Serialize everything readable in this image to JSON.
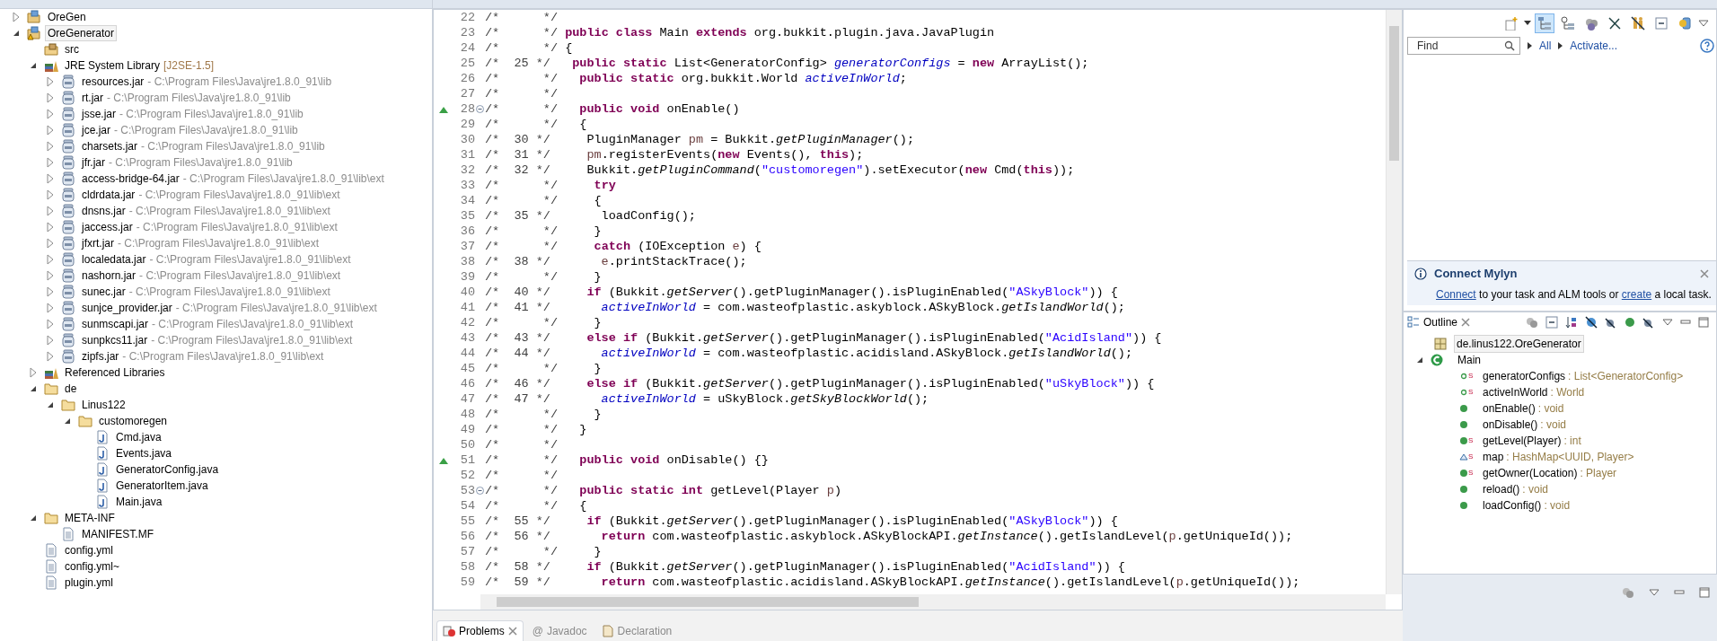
{
  "explorer": {
    "items": [
      {
        "label": "OreGen",
        "kind": "project",
        "expanded": false,
        "selected": false
      },
      {
        "label": "OreGenerator",
        "kind": "project-warning",
        "expanded": true,
        "selected": true,
        "children": [
          {
            "label": "src",
            "kind": "source-folder",
            "selected": false
          },
          {
            "label": "JRE System Library",
            "detail": "[J2SE-1.5]",
            "kind": "library",
            "expanded": true,
            "selected": false,
            "children": [
              {
                "label": "resources.jar",
                "detail": "- C:\\Program Files\\Java\\jre1.8.0_91\\lib",
                "kind": "jar",
                "expanded": false,
                "selected": false
              },
              {
                "label": "rt.jar",
                "detail": "- C:\\Program Files\\Java\\jre1.8.0_91\\lib",
                "kind": "jar",
                "expanded": false,
                "selected": false
              },
              {
                "label": "jsse.jar",
                "detail": "- C:\\Program Files\\Java\\jre1.8.0_91\\lib",
                "kind": "jar",
                "expanded": false,
                "selected": false
              },
              {
                "label": "jce.jar",
                "detail": "- C:\\Program Files\\Java\\jre1.8.0_91\\lib",
                "kind": "jar",
                "expanded": false,
                "selected": false
              },
              {
                "label": "charsets.jar",
                "detail": "- C:\\Program Files\\Java\\jre1.8.0_91\\lib",
                "kind": "jar",
                "expanded": false,
                "selected": false
              },
              {
                "label": "jfr.jar",
                "detail": "- C:\\Program Files\\Java\\jre1.8.0_91\\lib",
                "kind": "jar",
                "expanded": false,
                "selected": false
              },
              {
                "label": "access-bridge-64.jar",
                "detail": "- C:\\Program Files\\Java\\jre1.8.0_91\\lib\\ext",
                "kind": "jar",
                "expanded": false,
                "selected": false
              },
              {
                "label": "cldrdata.jar",
                "detail": "- C:\\Program Files\\Java\\jre1.8.0_91\\lib\\ext",
                "kind": "jar",
                "expanded": false,
                "selected": false
              },
              {
                "label": "dnsns.jar",
                "detail": "- C:\\Program Files\\Java\\jre1.8.0_91\\lib\\ext",
                "kind": "jar",
                "expanded": false,
                "selected": false
              },
              {
                "label": "jaccess.jar",
                "detail": "- C:\\Program Files\\Java\\jre1.8.0_91\\lib\\ext",
                "kind": "jar",
                "expanded": false,
                "selected": false
              },
              {
                "label": "jfxrt.jar",
                "detail": "- C:\\Program Files\\Java\\jre1.8.0_91\\lib\\ext",
                "kind": "jar",
                "expanded": false,
                "selected": false
              },
              {
                "label": "localedata.jar",
                "detail": "- C:\\Program Files\\Java\\jre1.8.0_91\\lib\\ext",
                "kind": "jar",
                "expanded": false,
                "selected": false
              },
              {
                "label": "nashorn.jar",
                "detail": "- C:\\Program Files\\Java\\jre1.8.0_91\\lib\\ext",
                "kind": "jar",
                "expanded": false,
                "selected": false
              },
              {
                "label": "sunec.jar",
                "detail": "- C:\\Program Files\\Java\\jre1.8.0_91\\lib\\ext",
                "kind": "jar",
                "expanded": false,
                "selected": false
              },
              {
                "label": "sunjce_provider.jar",
                "detail": "- C:\\Program Files\\Java\\jre1.8.0_91\\lib\\ext",
                "kind": "jar",
                "expanded": false,
                "selected": false
              },
              {
                "label": "sunmscapi.jar",
                "detail": "- C:\\Program Files\\Java\\jre1.8.0_91\\lib\\ext",
                "kind": "jar",
                "expanded": false,
                "selected": false
              },
              {
                "label": "sunpkcs11.jar",
                "detail": "- C:\\Program Files\\Java\\jre1.8.0_91\\lib\\ext",
                "kind": "jar",
                "expanded": false,
                "selected": false
              },
              {
                "label": "zipfs.jar",
                "detail": "- C:\\Program Files\\Java\\jre1.8.0_91\\lib\\ext",
                "kind": "jar",
                "expanded": false,
                "selected": false
              }
            ]
          },
          {
            "label": "Referenced Libraries",
            "kind": "library",
            "expanded": false,
            "selected": false
          },
          {
            "label": "de",
            "kind": "folder",
            "expanded": true,
            "selected": false,
            "children": [
              {
                "label": "Linus122",
                "kind": "folder",
                "expanded": true,
                "selected": false,
                "children": [
                  {
                    "label": "customoregen",
                    "kind": "folder",
                    "expanded": true,
                    "selected": false,
                    "children": [
                      {
                        "label": "Cmd.java",
                        "kind": "java",
                        "selected": false
                      },
                      {
                        "label": "Events.java",
                        "kind": "java",
                        "selected": false
                      },
                      {
                        "label": "GeneratorConfig.java",
                        "kind": "java",
                        "selected": false
                      },
                      {
                        "label": "GeneratorItem.java",
                        "kind": "java",
                        "selected": false
                      },
                      {
                        "label": "Main.java",
                        "kind": "java",
                        "selected": false
                      }
                    ]
                  }
                ]
              }
            ]
          },
          {
            "label": "META-INF",
            "kind": "folder",
            "expanded": true,
            "selected": false,
            "children": [
              {
                "label": "MANIFEST.MF",
                "kind": "text-file",
                "selected": false
              }
            ]
          },
          {
            "label": "config.yml",
            "kind": "text-file",
            "selected": false
          },
          {
            "label": "config.yml~",
            "kind": "text-file",
            "selected": false
          },
          {
            "label": "plugin.yml",
            "kind": "text-file",
            "selected": false
          }
        ]
      }
    ]
  },
  "editor": {
    "lines": [
      {
        "number": "22",
        "prefix": "/*      */",
        "override": false,
        "collapsible": false
      },
      {
        "number": "23",
        "prefix": "/*      */",
        "override": false,
        "collapsible": false,
        "tokens": [
          {
            "kind": "keyword",
            "text": "public class"
          },
          {
            "kind": "plain",
            "text": " Main "
          },
          {
            "kind": "keyword",
            "text": "extends"
          },
          {
            "kind": "plain",
            "text": " org.bukkit.plugin.java.JavaPlugin"
          }
        ]
      },
      {
        "number": "24",
        "prefix": "/*      */",
        "override": false,
        "collapsible": false,
        "tokens": [
          {
            "kind": "plain",
            "text": "{"
          }
        ]
      },
      {
        "number": "25",
        "prefix": "/*  25 */",
        "override": false,
        "collapsible": false,
        "tokens": [
          {
            "kind": "keyword",
            "text": "  public static"
          },
          {
            "kind": "plain",
            "text": " List<GeneratorConfig> "
          },
          {
            "kind": "field",
            "text": "generatorConfigs"
          },
          {
            "kind": "plain",
            "text": " = "
          },
          {
            "kind": "keyword",
            "text": "new"
          },
          {
            "kind": "plain",
            "text": " ArrayList();"
          }
        ]
      },
      {
        "number": "26",
        "prefix": "/*      */",
        "override": false,
        "collapsible": false,
        "tokens": [
          {
            "kind": "keyword",
            "text": "  public static"
          },
          {
            "kind": "plain",
            "text": " org.bukkit.World "
          },
          {
            "kind": "field",
            "text": "activeInWorld"
          },
          {
            "kind": "plain",
            "text": ";"
          }
        ]
      },
      {
        "number": "27",
        "prefix": "/*      */",
        "override": false,
        "collapsible": false
      },
      {
        "number": "28",
        "prefix": "/*      */",
        "override": true,
        "collapsible": true,
        "tokens": [
          {
            "kind": "keyword",
            "text": "  public void"
          },
          {
            "kind": "plain",
            "text": " onEnable()"
          }
        ]
      },
      {
        "number": "29",
        "prefix": "/*      */",
        "override": false,
        "collapsible": false,
        "tokens": [
          {
            "kind": "plain",
            "text": "  {"
          }
        ]
      },
      {
        "number": "30",
        "prefix": "/*  30 */",
        "override": false,
        "collapsible": false,
        "tokens": [
          {
            "kind": "plain",
            "text": "    PluginManager "
          },
          {
            "kind": "local",
            "text": "pm"
          },
          {
            "kind": "plain",
            "text": " = Bukkit."
          },
          {
            "kind": "static-method",
            "text": "getPluginManager"
          },
          {
            "kind": "plain",
            "text": "();"
          }
        ]
      },
      {
        "number": "31",
        "prefix": "/*  31 */",
        "override": false,
        "collapsible": false,
        "tokens": [
          {
            "kind": "local",
            "text": "    pm"
          },
          {
            "kind": "plain",
            "text": ".registerEvents("
          },
          {
            "kind": "keyword",
            "text": "new"
          },
          {
            "kind": "plain",
            "text": " Events(), "
          },
          {
            "kind": "keyword",
            "text": "this"
          },
          {
            "kind": "plain",
            "text": ");"
          }
        ]
      },
      {
        "number": "32",
        "prefix": "/*  32 */",
        "override": false,
        "collapsible": false,
        "tokens": [
          {
            "kind": "plain",
            "text": "    Bukkit."
          },
          {
            "kind": "static-method",
            "text": "getPluginCommand"
          },
          {
            "kind": "plain",
            "text": "("
          },
          {
            "kind": "string",
            "text": "\"customoregen\""
          },
          {
            "kind": "plain",
            "text": ").setExecutor("
          },
          {
            "kind": "keyword",
            "text": "new"
          },
          {
            "kind": "plain",
            "text": " Cmd("
          },
          {
            "kind": "keyword",
            "text": "this"
          },
          {
            "kind": "plain",
            "text": "));"
          }
        ]
      },
      {
        "number": "33",
        "prefix": "/*      */",
        "override": false,
        "collapsible": false,
        "tokens": [
          {
            "kind": "keyword",
            "text": "    try"
          }
        ]
      },
      {
        "number": "34",
        "prefix": "/*      */",
        "override": false,
        "collapsible": false,
        "tokens": [
          {
            "kind": "plain",
            "text": "    {"
          }
        ]
      },
      {
        "number": "35",
        "prefix": "/*  35 */",
        "override": false,
        "collapsible": false,
        "tokens": [
          {
            "kind": "plain",
            "text": "      loadConfig();"
          }
        ]
      },
      {
        "number": "36",
        "prefix": "/*      */",
        "override": false,
        "collapsible": false,
        "tokens": [
          {
            "kind": "plain",
            "text": "    }"
          }
        ]
      },
      {
        "number": "37",
        "prefix": "/*      */",
        "override": false,
        "collapsible": false,
        "tokens": [
          {
            "kind": "keyword",
            "text": "    catch"
          },
          {
            "kind": "plain",
            "text": " (IOException "
          },
          {
            "kind": "local",
            "text": "e"
          },
          {
            "kind": "plain",
            "text": ") {"
          }
        ]
      },
      {
        "number": "38",
        "prefix": "/*  38 */",
        "override": false,
        "collapsible": false,
        "tokens": [
          {
            "kind": "local",
            "text": "      e"
          },
          {
            "kind": "plain",
            "text": ".printStackTrace();"
          }
        ]
      },
      {
        "number": "39",
        "prefix": "/*      */",
        "override": false,
        "collapsible": false,
        "tokens": [
          {
            "kind": "plain",
            "text": "    }"
          }
        ]
      },
      {
        "number": "40",
        "prefix": "/*  40 */",
        "override": false,
        "collapsible": false,
        "tokens": [
          {
            "kind": "keyword",
            "text": "    if"
          },
          {
            "kind": "plain",
            "text": " (Bukkit."
          },
          {
            "kind": "static-method",
            "text": "getServer"
          },
          {
            "kind": "plain",
            "text": "().getPluginManager().isPluginEnabled("
          },
          {
            "kind": "string",
            "text": "\"ASkyBlock\""
          },
          {
            "kind": "plain",
            "text": ")) {"
          }
        ]
      },
      {
        "number": "41",
        "prefix": "/*  41 */",
        "override": false,
        "collapsible": false,
        "tokens": [
          {
            "kind": "field",
            "text": "      activeInWorld"
          },
          {
            "kind": "plain",
            "text": " = com.wasteofplastic.askyblock.ASkyBlock."
          },
          {
            "kind": "static-method",
            "text": "getIslandWorld"
          },
          {
            "kind": "plain",
            "text": "();"
          }
        ]
      },
      {
        "number": "42",
        "prefix": "/*      */",
        "override": false,
        "collapsible": false,
        "tokens": [
          {
            "kind": "plain",
            "text": "    }"
          }
        ]
      },
      {
        "number": "43",
        "prefix": "/*  43 */",
        "override": false,
        "collapsible": false,
        "tokens": [
          {
            "kind": "keyword",
            "text": "    else if"
          },
          {
            "kind": "plain",
            "text": " (Bukkit."
          },
          {
            "kind": "static-method",
            "text": "getServer"
          },
          {
            "kind": "plain",
            "text": "().getPluginManager().isPluginEnabled("
          },
          {
            "kind": "string",
            "text": "\"AcidIsland\""
          },
          {
            "kind": "plain",
            "text": ")) {"
          }
        ]
      },
      {
        "number": "44",
        "prefix": "/*  44 */",
        "override": false,
        "collapsible": false,
        "tokens": [
          {
            "kind": "field",
            "text": "      activeInWorld"
          },
          {
            "kind": "plain",
            "text": " = com.wasteofplastic.acidisland.ASkyBlock."
          },
          {
            "kind": "static-method",
            "text": "getIslandWorld"
          },
          {
            "kind": "plain",
            "text": "();"
          }
        ]
      },
      {
        "number": "45",
        "prefix": "/*      */",
        "override": false,
        "collapsible": false,
        "tokens": [
          {
            "kind": "plain",
            "text": "    }"
          }
        ]
      },
      {
        "number": "46",
        "prefix": "/*  46 */",
        "override": false,
        "collapsible": false,
        "tokens": [
          {
            "kind": "keyword",
            "text": "    else if"
          },
          {
            "kind": "plain",
            "text": " (Bukkit."
          },
          {
            "kind": "static-method",
            "text": "getServer"
          },
          {
            "kind": "plain",
            "text": "().getPluginManager().isPluginEnabled("
          },
          {
            "kind": "string",
            "text": "\"uSkyBlock\""
          },
          {
            "kind": "plain",
            "text": ")) {"
          }
        ]
      },
      {
        "number": "47",
        "prefix": "/*  47 */",
        "override": false,
        "collapsible": false,
        "tokens": [
          {
            "kind": "field",
            "text": "      activeInWorld"
          },
          {
            "kind": "plain",
            "text": " = uSkyBlock."
          },
          {
            "kind": "static-method",
            "text": "getSkyBlockWorld"
          },
          {
            "kind": "plain",
            "text": "();"
          }
        ]
      },
      {
        "number": "48",
        "prefix": "/*      */",
        "override": false,
        "collapsible": false,
        "tokens": [
          {
            "kind": "plain",
            "text": "    }"
          }
        ]
      },
      {
        "number": "49",
        "prefix": "/*      */",
        "override": false,
        "collapsible": false,
        "tokens": [
          {
            "kind": "plain",
            "text": "  }"
          }
        ]
      },
      {
        "number": "50",
        "prefix": "/*      */",
        "override": false,
        "collapsible": false
      },
      {
        "number": "51",
        "prefix": "/*      */",
        "override": true,
        "collapsible": false,
        "tokens": [
          {
            "kind": "keyword",
            "text": "  public void"
          },
          {
            "kind": "plain",
            "text": " onDisable() {}"
          }
        ]
      },
      {
        "number": "52",
        "prefix": "/*      */",
        "override": false,
        "collapsible": false
      },
      {
        "number": "53",
        "prefix": "/*      */",
        "override": false,
        "collapsible": true,
        "tokens": [
          {
            "kind": "keyword",
            "text": "  public static int"
          },
          {
            "kind": "plain",
            "text": " getLevel(Player "
          },
          {
            "kind": "local",
            "text": "p"
          },
          {
            "kind": "plain",
            "text": ")"
          }
        ]
      },
      {
        "number": "54",
        "prefix": "/*      */",
        "override": false,
        "collapsible": false,
        "tokens": [
          {
            "kind": "plain",
            "text": "  {"
          }
        ]
      },
      {
        "number": "55",
        "prefix": "/*  55 */",
        "override": false,
        "collapsible": false,
        "tokens": [
          {
            "kind": "keyword",
            "text": "    if"
          },
          {
            "kind": "plain",
            "text": " (Bukkit."
          },
          {
            "kind": "static-method",
            "text": "getServer"
          },
          {
            "kind": "plain",
            "text": "().getPluginManager().isPluginEnabled("
          },
          {
            "kind": "string",
            "text": "\"ASkyBlock\""
          },
          {
            "kind": "plain",
            "text": ")) {"
          }
        ]
      },
      {
        "number": "56",
        "prefix": "/*  56 */",
        "override": false,
        "collapsible": false,
        "tokens": [
          {
            "kind": "keyword",
            "text": "      return"
          },
          {
            "kind": "plain",
            "text": " com.wasteofplastic.askyblock.ASkyBlockAPI."
          },
          {
            "kind": "static-method",
            "text": "getInstance"
          },
          {
            "kind": "plain",
            "text": "().getIslandLevel("
          },
          {
            "kind": "local",
            "text": "p"
          },
          {
            "kind": "plain",
            "text": ".getUniqueId());"
          }
        ]
      },
      {
        "number": "57",
        "prefix": "/*      */",
        "override": false,
        "collapsible": false,
        "tokens": [
          {
            "kind": "plain",
            "text": "    }"
          }
        ]
      },
      {
        "number": "58",
        "prefix": "/*  58 */",
        "override": false,
        "collapsible": false,
        "tokens": [
          {
            "kind": "keyword",
            "text": "    if"
          },
          {
            "kind": "plain",
            "text": " (Bukkit."
          },
          {
            "kind": "static-method",
            "text": "getServer"
          },
          {
            "kind": "plain",
            "text": "().getPluginManager().isPluginEnabled("
          },
          {
            "kind": "string",
            "text": "\"AcidIsland\""
          },
          {
            "kind": "plain",
            "text": ")) {"
          }
        ]
      },
      {
        "number": "59",
        "prefix": "/*  59 */",
        "override": false,
        "collapsible": false,
        "tokens": [
          {
            "kind": "keyword",
            "text": "      return"
          },
          {
            "kind": "plain",
            "text": " com.wasteofplastic.acidisland.ASkyBlockAPI."
          },
          {
            "kind": "static-method",
            "text": "getInstance"
          },
          {
            "kind": "plain",
            "text": "().getIslandLevel("
          },
          {
            "kind": "local",
            "text": "p"
          },
          {
            "kind": "plain",
            "text": ".getUniqueId());"
          }
        ]
      }
    ]
  },
  "bottom_tabs": [
    {
      "label": "Problems",
      "kind": "problems",
      "selected": true
    },
    {
      "label": "Javadoc",
      "glyph": "@",
      "selected": false
    },
    {
      "label": "Declaration",
      "kind": "declaration",
      "selected": false
    }
  ],
  "task_list": {
    "toolbar": [
      {
        "kind": "new-task",
        "pressed": false
      },
      {
        "kind": "categorized",
        "pressed": true
      },
      {
        "kind": "scheduled",
        "pressed": false
      },
      {
        "kind": "presentation",
        "pressed": false
      },
      {
        "kind": "hide-completed",
        "pressed": false
      },
      {
        "kind": "focus",
        "pressed": false
      },
      {
        "kind": "collapse",
        "pressed": false
      },
      {
        "kind": "sync",
        "pressed": false
      }
    ],
    "search": {
      "placeholder": "Find"
    },
    "filters": [
      "All",
      "Activate..."
    ],
    "mylyn": {
      "title": "Connect Mylyn",
      "message": [
        {
          "text": "Connect",
          "link": true
        },
        {
          "text": "to your task and ALM tools or",
          "link": false
        },
        {
          "text": "create",
          "link": true
        },
        {
          "text": "a local task.",
          "link": false
        }
      ]
    }
  },
  "outline": {
    "tab": {
      "label": "Outline",
      "selected": true
    },
    "package": {
      "label": "de.linus122.OreGenerator",
      "selected": true
    },
    "class": {
      "label": "Main",
      "expanded": true,
      "members": [
        {
          "name": "generatorConfigs",
          "type": ": List<GeneratorConfig>",
          "kind": "public-field",
          "static_mark": "S"
        },
        {
          "name": "activeInWorld",
          "type": ": World",
          "kind": "public-field",
          "static_mark": "S"
        },
        {
          "name": "onEnable()",
          "type": ": void",
          "kind": "method"
        },
        {
          "name": "onDisable()",
          "type": ": void",
          "kind": "method"
        },
        {
          "name": "getLevel(Player)",
          "type": ": int",
          "kind": "method",
          "static_mark": "S"
        },
        {
          "name": "map",
          "type": ": HashMap<UUID, Player>",
          "kind": "default-field",
          "static_mark": "S"
        },
        {
          "name": "getOwner(Location)",
          "type": ": Player",
          "kind": "method",
          "static_mark": "S"
        },
        {
          "name": "reload()",
          "type": ": void",
          "kind": "method"
        },
        {
          "name": "loadConfig()",
          "type": ": void",
          "kind": "method"
        }
      ]
    }
  }
}
